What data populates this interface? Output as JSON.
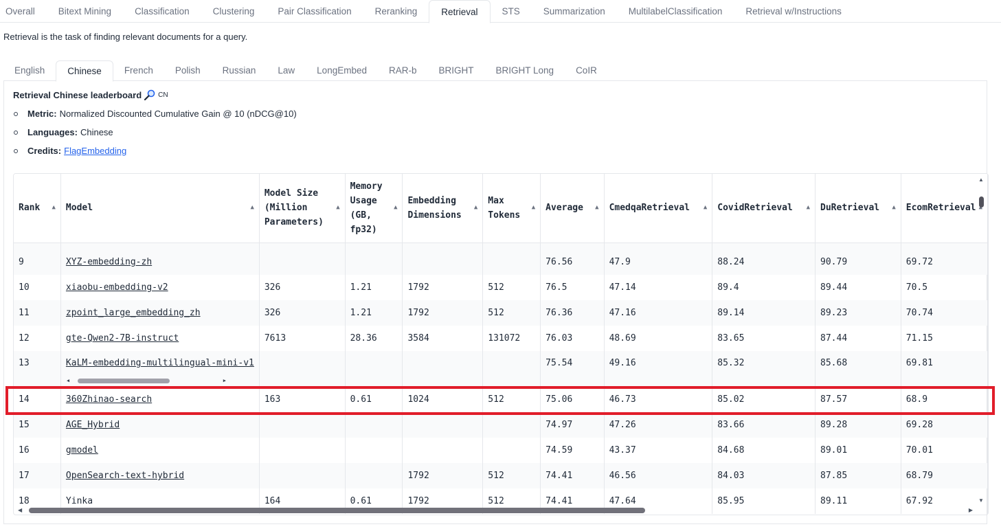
{
  "top_tabs": [
    "Overall",
    "Bitext Mining",
    "Classification",
    "Clustering",
    "Pair Classification",
    "Reranking",
    "Retrieval",
    "STS",
    "Summarization",
    "MultilabelClassification",
    "Retrieval w/Instructions"
  ],
  "top_tab_active": "Retrieval",
  "description": "Retrieval is the task of finding relevant documents for a query.",
  "sub_tabs": [
    "English",
    "Chinese",
    "French",
    "Polish",
    "Russian",
    "Law",
    "LongEmbed",
    "RAR-b",
    "BRIGHT",
    "BRIGHT Long",
    "CoIR"
  ],
  "sub_tab_active": "Chinese",
  "leaderboard": {
    "title": "Retrieval Chinese leaderboard",
    "title_suffix": "CN",
    "metric_label": "Metric:",
    "metric_value": "Normalized Discounted Cumulative Gain @ 10 (nDCG@10)",
    "languages_label": "Languages:",
    "languages_value": "Chinese",
    "credits_label": "Credits:",
    "credits_link": "FlagEmbedding"
  },
  "table": {
    "headers": [
      "Rank",
      "Model",
      "Model Size (Million Parameters)",
      "Memory Usage (GB, fp32)",
      "Embedding Dimensions",
      "Max Tokens",
      "Average",
      "CmedqaRetrieval",
      "CovidRetrieval",
      "DuRetrieval",
      "EcomRetrieval"
    ],
    "rows": [
      [
        "9",
        "XYZ-embedding-zh",
        "",
        "",
        "",
        "",
        "76.56",
        "47.9",
        "88.24",
        "90.79",
        "69.72"
      ],
      [
        "10",
        "xiaobu-embedding-v2",
        "326",
        "1.21",
        "1792",
        "512",
        "76.5",
        "47.14",
        "89.4",
        "89.44",
        "70.5"
      ],
      [
        "11",
        "zpoint_large_embedding_zh",
        "326",
        "1.21",
        "1792",
        "512",
        "76.36",
        "47.16",
        "89.14",
        "89.23",
        "70.74"
      ],
      [
        "12",
        "gte-Qwen2-7B-instruct",
        "7613",
        "28.36",
        "3584",
        "131072",
        "76.03",
        "48.69",
        "83.65",
        "87.44",
        "71.15"
      ],
      [
        "13",
        "KaLM-embedding-multilingual-mini-v1",
        "",
        "",
        "",
        "",
        "75.54",
        "49.16",
        "85.32",
        "85.68",
        "69.81"
      ],
      [
        "14",
        "360Zhinao-search",
        "163",
        "0.61",
        "1024",
        "512",
        "75.06",
        "46.73",
        "85.02",
        "87.57",
        "68.9"
      ],
      [
        "15",
        "AGE_Hybrid",
        "",
        "",
        "",
        "",
        "74.97",
        "47.26",
        "83.66",
        "89.28",
        "69.28"
      ],
      [
        "16",
        "gmodel",
        "",
        "",
        "",
        "",
        "74.59",
        "43.37",
        "84.68",
        "89.01",
        "70.01"
      ],
      [
        "17",
        "OpenSearch-text-hybrid",
        "",
        "",
        "1792",
        "512",
        "74.41",
        "46.56",
        "84.03",
        "87.85",
        "68.79"
      ],
      [
        "18",
        "Yinka",
        "164",
        "0.61",
        "1792",
        "512",
        "74.41",
        "47.64",
        "85.95",
        "89.11",
        "67.92"
      ]
    ],
    "linked_models": [
      "XYZ-embedding-zh",
      "xiaobu-embedding-v2",
      "zpoint_large_embedding_zh",
      "gte-Qwen2-7B-instruct",
      "KaLM-embedding-multilingual-mini-v1",
      "360Zhinao-search",
      "AGE_Hybrid",
      "gmodel",
      "OpenSearch-text-hybrid"
    ],
    "highlighted_rank": "14"
  },
  "colors": {
    "highlight": "#e11d2a",
    "link": "#2563eb"
  },
  "icons": {
    "title_icon": "magnifier-icon",
    "sort": "sort-arrow-icon"
  }
}
